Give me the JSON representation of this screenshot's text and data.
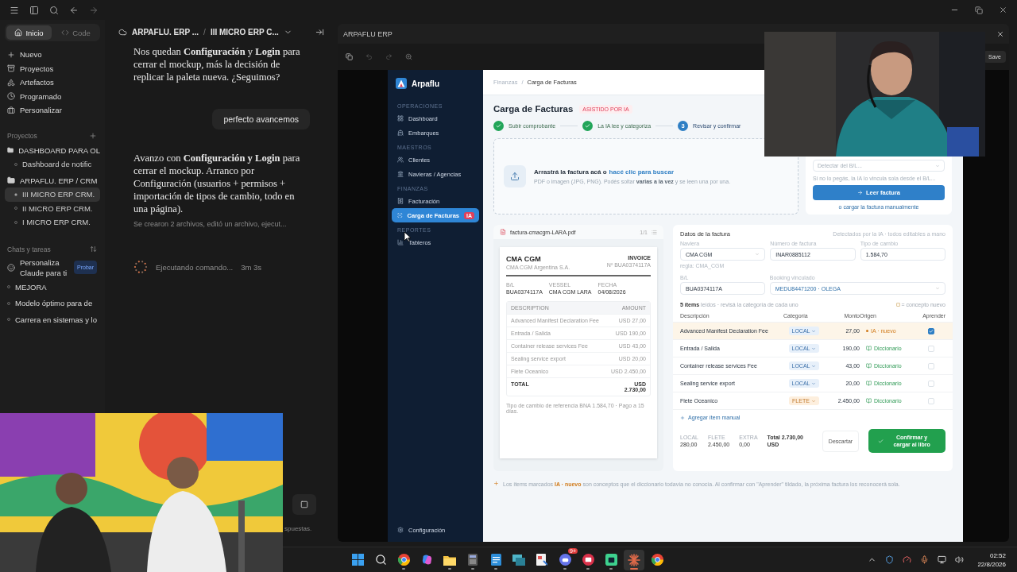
{
  "topbar": {
    "breadcrumb": [
      "ARPAFLU. ERP ...",
      "III MICRO ERP C..."
    ],
    "separator": "/"
  },
  "claude_sidebar": {
    "mode_tabs": [
      {
        "label": "Inicio",
        "selected": true
      },
      {
        "label": "Code",
        "selected": false
      }
    ],
    "nav": [
      {
        "label": "Nuevo",
        "kind": "new"
      },
      {
        "label": "Proyectos",
        "kind": "projects"
      },
      {
        "label": "Artefactos",
        "kind": "artifacts"
      },
      {
        "label": "Programado",
        "kind": "scheduled"
      },
      {
        "label": "Personalizar",
        "kind": "customize"
      }
    ],
    "projects_title": "Proyectos",
    "projects": [
      {
        "label": "DASHBOARD PARA OL",
        "children": [
          {
            "label": "Dashboard de notific",
            "selected": false
          }
        ]
      },
      {
        "label": "ARPAFLU. ERP / CRM",
        "children": [
          {
            "label": "III MICRO ERP CRM.",
            "selected": true
          },
          {
            "label": "II MICRO ERP CRM.",
            "selected": false
          },
          {
            "label": "I MICRO ERP CRM.",
            "selected": false
          }
        ]
      }
    ],
    "chats_title": "Chats y tareas",
    "promo": {
      "text": "Personaliza Claude para ti",
      "badge": "Probar"
    },
    "chats": [
      "MEJORA",
      "Modelo óptimo para de",
      "Carrera en sistemas y lo"
    ]
  },
  "chat": {
    "messages": [
      {
        "kind": "assistant",
        "text": "Nos quedan **Configuración** y **Login** para cerrar el mockup, más la decisión de replicar la paleta nueva. ¿Seguimos?"
      },
      {
        "kind": "user",
        "text": "perfecto avancemos"
      },
      {
        "kind": "assistant",
        "text": "Avanzo con **Configuración y Login** para cerrar el mockup. Arranco por Configuración (usuarios + permisos + importación de tipos de cambio, todo en una página)."
      },
      {
        "kind": "summary",
        "text": "Se crearon 2 archivos, editó un archivo, ejecut..."
      }
    ],
    "status": {
      "text": "Ejecutando comando...",
      "time": "3m 3s"
    },
    "tail": "spuestas."
  },
  "erp": {
    "window_title": "ARPAFLU ERP",
    "save": "Save",
    "brand": "Arpaflu",
    "nav": [
      {
        "section": "OPERACIONES",
        "items": [
          {
            "label": "Dashboard",
            "kind": "grid",
            "selected": false
          },
          {
            "label": "Embarques",
            "kind": "ship",
            "selected": false
          }
        ]
      },
      {
        "section": "MAESTROS",
        "items": [
          {
            "label": "Clientes",
            "kind": "people",
            "selected": false
          },
          {
            "label": "Navieras / Agencias",
            "kind": "building",
            "selected": false
          }
        ]
      },
      {
        "section": "FINANZAS",
        "items": [
          {
            "label": "Facturación",
            "kind": "receipt",
            "selected": false
          },
          {
            "label": "Carga de Facturas",
            "kind": "scan",
            "selected": true,
            "badge": "IA"
          }
        ]
      },
      {
        "section": "REPORTES",
        "items": [
          {
            "label": "Tableros",
            "kind": "chart",
            "selected": false
          }
        ]
      }
    ],
    "settings": "Configuración",
    "breadcrumb": [
      "Finanzas",
      "Carga de Facturas"
    ],
    "title": "Carga de Facturas",
    "title_badge": "ASISTIDO POR IA",
    "steps": [
      {
        "label": "Subir comprobante",
        "done": true
      },
      {
        "label": "La IA lee y categoriza",
        "done": true
      },
      {
        "label": "Revisar y confirmar",
        "done": false,
        "number": "3"
      }
    ],
    "dropzone": {
      "text": "Arrastrá la factura acá o",
      "link": "hacé clic para buscar",
      "hint": "PDF o imagen (JPG, PNG). Podés soltar **varias a la vez** y se leen una por una."
    },
    "side_card": {
      "select_placeholder": "Detectar del B/L...",
      "note": "Si no lo pegás, la IA lo vincula sola desde el B/L...",
      "button": "Leer factura",
      "link": "o cargar la factura manualmente"
    },
    "preview": {
      "filename": "factura-cmacgm-LARA.pdf",
      "pages": "1/1",
      "company": "CMA CGM",
      "company_sub": "CMA CGM Argentina S.A.",
      "doc_title": "INVOICE",
      "doc_number": "Nº BUA0374117A",
      "meta": [
        {
          "label": "B/L",
          "value": "BUA0374117A"
        },
        {
          "label": "VESSEL",
          "value": "CMA CGM LARA"
        },
        {
          "label": "FECHA",
          "value": "04/08/2026"
        }
      ],
      "columns": [
        "DESCRIPTION",
        "AMOUNT"
      ],
      "lines": [
        {
          "desc": "Advanced Manifest Declaration Fee",
          "amount": "USD 27,00"
        },
        {
          "desc": "Entrada / Salida",
          "amount": "USD 190,00"
        },
        {
          "desc": "Container release services Fee",
          "amount": "USD 43,00"
        },
        {
          "desc": "Sealing service export",
          "amount": "USD 20,00"
        },
        {
          "desc": "Flete Oceanico",
          "amount": "USD 2.450,00"
        }
      ],
      "total_label": "TOTAL",
      "total": "USD 2.730,00",
      "footnote": "Tipo de cambio de referencia BNA 1.584,70 · Pago a 15 días."
    },
    "form": {
      "title": "Datos de la factura",
      "note": "Detectados por la IA · todos editables a mano",
      "fields": [
        {
          "label": "Naviera",
          "value": "CMA CGM",
          "kind": "select"
        },
        {
          "label": "Número de factura",
          "value": "INAR0885112",
          "kind": "text"
        },
        {
          "label": "Tipo de cambio",
          "value": "1.584,70",
          "kind": "text"
        }
      ],
      "rule": "regla: CMA_CGM",
      "fields2": [
        {
          "label": "B/L",
          "value": "BUA0374117A",
          "kind": "text"
        },
        {
          "label": "Booking vinculado",
          "value": "MEDU84471200 · OLEGA",
          "kind": "linked"
        }
      ],
      "items_summary": "**5 ítems** leídos · revisá la categoría de cada uno",
      "legend": "= concepto nuevo",
      "columns": [
        "Descripción",
        "Categoría",
        "Monto",
        "Origen",
        "Aprender"
      ],
      "rows": [
        {
          "kind": "ia",
          "desc": "Advanced Manifest Declaration Fee",
          "category": {
            "label": "LOCAL",
            "kind": "local"
          },
          "amount": "27,00",
          "origin": "IA · nuevo",
          "learn": true
        },
        {
          "kind": "dictionary",
          "desc": "Entrada / Salida",
          "category": {
            "label": "LOCAL",
            "kind": "local"
          },
          "amount": "190,00",
          "origin": "Diccionario",
          "learn": false
        },
        {
          "kind": "dictionary",
          "desc": "Container release services Fee",
          "category": {
            "label": "LOCAL",
            "kind": "local"
          },
          "amount": "43,00",
          "origin": "Diccionario",
          "learn": false
        },
        {
          "kind": "dictionary",
          "desc": "Sealing service export",
          "category": {
            "label": "LOCAL",
            "kind": "local"
          },
          "amount": "20,00",
          "origin": "Diccionario",
          "learn": false
        },
        {
          "kind": "dictionary",
          "desc": "Flete Oceanico",
          "category": {
            "label": "FLETE",
            "kind": "freight"
          },
          "amount": "2.450,00",
          "origin": "Diccionario",
          "learn": false
        }
      ],
      "add_item": "Agregar ítem manual",
      "totals": [
        {
          "label": "LOCAL",
          "value": "280,00"
        },
        {
          "label": "FLETE",
          "value": "2.450,00"
        },
        {
          "label": "EXTRA",
          "value": "0,00"
        }
      ],
      "grand_total": "Total 2.730,00 USD",
      "discard": "Descartar",
      "confirm": "Confirmar y cargar al libro"
    },
    "footnote": "Los ítems marcados **IA · nuevo** son conceptos que el diccionario todavía no conocía. Al confirmar con \"Aprender\" tildado, la próxima factura los reconocerá sola."
  },
  "taskbar": {
    "apps": [
      {
        "kind": "windows",
        "running": false,
        "active": false
      },
      {
        "kind": "search",
        "running": false,
        "active": false
      },
      {
        "kind": "browser",
        "running": true,
        "active": false
      },
      {
        "kind": "swirl",
        "running": false,
        "active": false
      },
      {
        "kind": "folder",
        "running": true,
        "active": false
      },
      {
        "kind": "calculator",
        "running": true,
        "active": false
      },
      {
        "kind": "notepad",
        "running": true,
        "active": false
      },
      {
        "kind": "stack",
        "running": false,
        "active": false
      },
      {
        "kind": "clipboard",
        "running": false,
        "active": false
      },
      {
        "kind": "chat",
        "running": true,
        "active": false,
        "badge": "9+"
      },
      {
        "kind": "red",
        "running": true,
        "active": false
      },
      {
        "kind": "green",
        "running": true,
        "active": false
      },
      {
        "kind": "spark",
        "running": true,
        "active": true
      },
      {
        "kind": "browser",
        "running": false,
        "active": false
      }
    ],
    "time": "02:52",
    "date": "22/8/2026"
  }
}
